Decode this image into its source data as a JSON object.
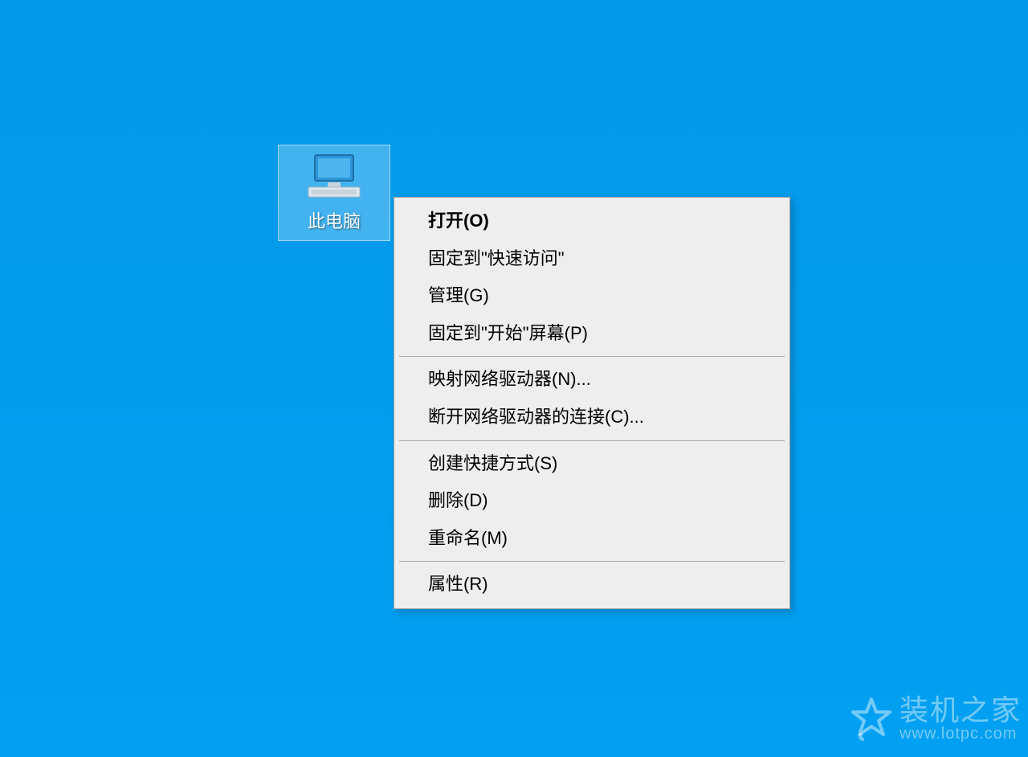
{
  "desktop": {
    "icon_label": "此电脑"
  },
  "context_menu": {
    "items": [
      {
        "label": "打开(O)",
        "bold": true
      },
      {
        "label": "固定到\"快速访问\""
      },
      {
        "label": "管理(G)"
      },
      {
        "label": "固定到\"开始\"屏幕(P)"
      },
      {
        "separator": true
      },
      {
        "label": "映射网络驱动器(N)..."
      },
      {
        "label": "断开网络驱动器的连接(C)..."
      },
      {
        "separator": true
      },
      {
        "label": "创建快捷方式(S)"
      },
      {
        "label": "删除(D)"
      },
      {
        "label": "重命名(M)"
      },
      {
        "separator": true
      },
      {
        "label": "属性(R)"
      }
    ]
  },
  "watermark": {
    "title": "装机之家",
    "url": "www.lotpc.com"
  }
}
